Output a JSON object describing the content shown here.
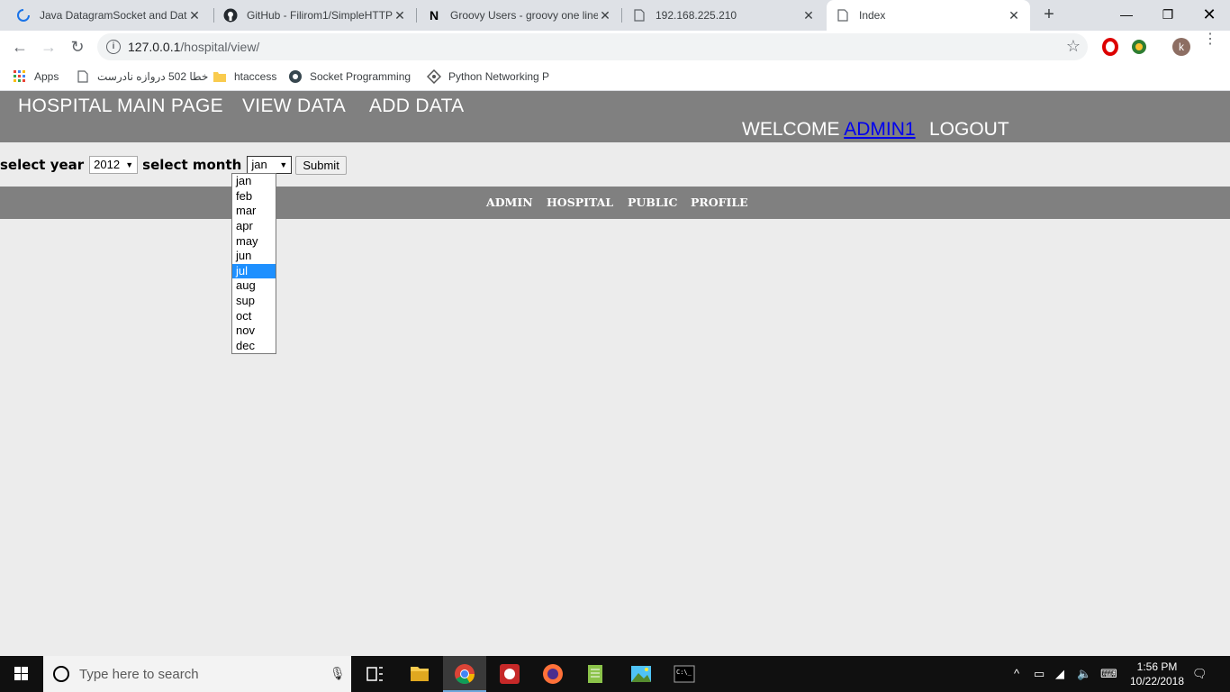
{
  "browser": {
    "tabs": [
      {
        "title": "Java DatagramSocket and Data",
        "icon": "loading-spinner-icon",
        "active": false
      },
      {
        "title": "GitHub - Filirom1/SimpleHTTP",
        "icon": "github-icon",
        "active": false
      },
      {
        "title": "Groovy Users - groovy one line",
        "icon": "nabble-n-icon",
        "active": false
      },
      {
        "title": "192.168.225.210",
        "icon": "page-icon",
        "active": false
      },
      {
        "title": "Index",
        "icon": "page-icon",
        "active": true
      }
    ],
    "url_host": "127.0.0.1",
    "url_path": "/hospital/view/",
    "avatar_letter": "k",
    "bookmarks": [
      {
        "label": "Apps",
        "icon": "apps-grid-icon"
      },
      {
        "label": "خطا 502 دروازه نادرست",
        "icon": "page-icon"
      },
      {
        "label": "htaccess",
        "icon": "folder-icon"
      },
      {
        "label": "Socket Programming",
        "icon": "globe-icon"
      },
      {
        "label": "Python Networking P",
        "icon": "diamond-icon"
      }
    ]
  },
  "page": {
    "nav": {
      "main": "HOSPITAL MAIN PAGE",
      "view": "VIEW DATA",
      "add": "ADD DATA"
    },
    "welcome_text": "WELCOME",
    "username": "ADMIN1",
    "logout": "LOGOUT",
    "form": {
      "year_label": "select year",
      "year_value": "2012",
      "month_label": "select month",
      "month_value": "jan",
      "submit": "Submit",
      "month_options": [
        "jan",
        "feb",
        "mar",
        "apr",
        "may",
        "jun",
        "jul",
        "aug",
        "sup",
        "oct",
        "nov",
        "dec"
      ],
      "highlighted_option": "jul"
    },
    "subnav": [
      "ADMIN",
      "HOSPITAL",
      "PUBLIC",
      "PROFILE"
    ]
  },
  "taskbar": {
    "search_placeholder": "Type here to search",
    "time": "1:56 PM",
    "date": "10/22/2018"
  }
}
